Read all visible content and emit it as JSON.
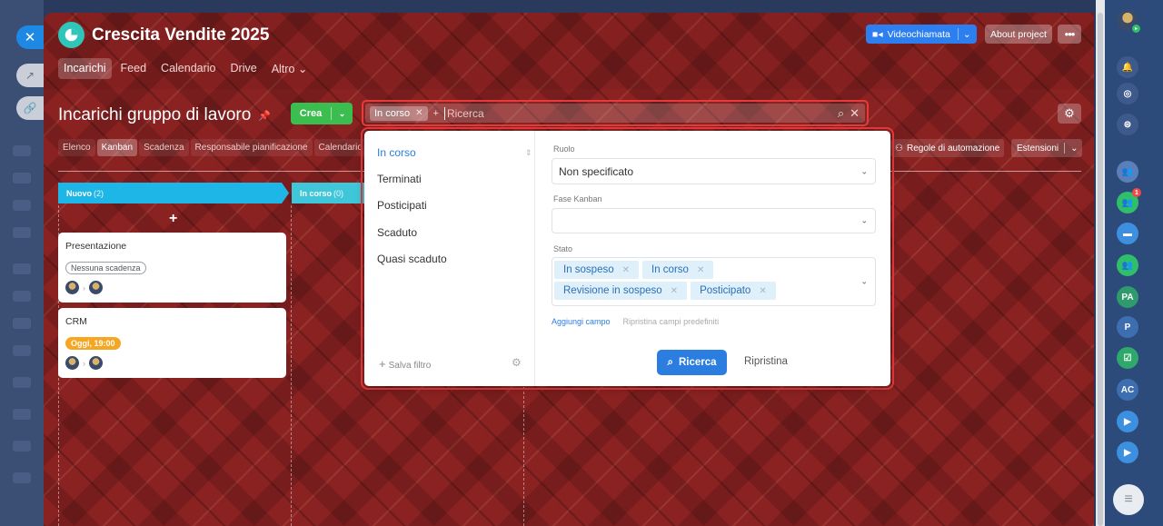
{
  "project": {
    "title": "Crescita Vendite 2025",
    "nav": [
      "Incarichi",
      "Feed",
      "Calendario",
      "Drive",
      "Altro"
    ],
    "nav_more_caret": "⌄",
    "video_call": "Videochiamata",
    "about": "About project",
    "more": "•••"
  },
  "page": {
    "title": "Incarichi gruppo di lavoro",
    "create_button": "Crea"
  },
  "search": {
    "active_chip": "In corso",
    "plus": "+",
    "placeholder": "Ricerca"
  },
  "views": {
    "tabs": [
      "Elenco",
      "Kanban",
      "Scadenza",
      "Responsabile pianificazione",
      "Calendario"
    ],
    "active": "Kanban",
    "automation": "Regole di automazione",
    "extensions": "Estensioni"
  },
  "kanban": {
    "columns": [
      {
        "name": "Nuovo",
        "count": "(2)",
        "color": "#1eb6e6"
      },
      {
        "name": "In corso",
        "count": "(0)",
        "color": "#3fc6d8"
      }
    ],
    "add": "+",
    "cards": [
      {
        "title": "Presentazione",
        "deadline": "Nessuna scadenza"
      },
      {
        "title": "CRM",
        "deadline": "Oggi, 19:00"
      }
    ]
  },
  "filter": {
    "presets": [
      "In corso",
      "Terminati",
      "Posticipati",
      "Scaduto",
      "Quasi scaduto"
    ],
    "active_preset": "In corso",
    "save_filter": "Salva filtro",
    "fields": {
      "role": {
        "label": "Ruolo",
        "value": "Non specificato"
      },
      "kanban_stage": {
        "label": "Fase Kanban",
        "value": ""
      },
      "status": {
        "label": "Stato",
        "values": [
          "In sospeso",
          "In corso",
          "Revisione in sospeso",
          "Posticipato"
        ]
      }
    },
    "add_field": "Aggiungi campo",
    "restore_defaults": "Ripristina campi predefiniti",
    "search_button": "Ricerca",
    "reset_button": "Ripristina"
  },
  "sidebar_right": {
    "badge": "1",
    "initials": [
      "PA",
      "P",
      "AC"
    ]
  },
  "colors": {
    "accent": "#2b7de0",
    "create": "#3bbd4f",
    "highlight": "#e53b3b",
    "deadline_today": "#f5a623"
  }
}
